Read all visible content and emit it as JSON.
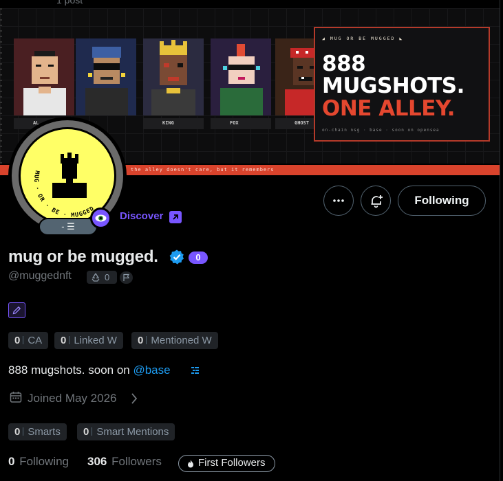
{
  "topbar": {
    "post_count_label": "1 post"
  },
  "banner": {
    "strip_text": "the alley doesn't care, but it remembers",
    "mug_labels": [
      "AL",
      "KING",
      "FOX",
      "GHOST"
    ],
    "promo": {
      "kicker": "◢ MUG OR BE MUGGED ◣",
      "line1": "888",
      "line2": "MUGSHOTS.",
      "line3": "ONE ALLEY.",
      "footer": "on-chain nsg · base · soon on opensea"
    },
    "colors": {
      "accent_red": "#d9432c",
      "promo_red": "#e4472f"
    }
  },
  "avatar": {
    "ring_text": "MUG · OR · BE · MUGGED",
    "pill_label": "- ☰"
  },
  "actions": {
    "more_icon": "more-icon",
    "notify_icon": "bell-plus-icon",
    "following_label": "Following"
  },
  "discover": {
    "label": "Discover"
  },
  "profile": {
    "name": "mug or be mugged.",
    "name_count": "0",
    "handle": "@muggednft",
    "recycle_count": "0",
    "stats": [
      {
        "value": "0",
        "label": "CA"
      },
      {
        "value": "0",
        "label": "Linked W"
      },
      {
        "value": "0",
        "label": "Mentioned W"
      }
    ],
    "bio_text": "888 mugshots. soon on ",
    "bio_link": "@base",
    "joined": "Joined May 2026",
    "smart_stats": [
      {
        "value": "0",
        "label": "Smarts"
      },
      {
        "value": "0",
        "label": "Smart Mentions"
      }
    ],
    "following_count": "0",
    "following_label": "Following",
    "followers_count": "306",
    "followers_label": "Followers",
    "first_followers_label": "First Followers"
  },
  "colors": {
    "purple": "#7856ff",
    "link_blue": "#1d9bf0",
    "muted": "#71767b",
    "pill_bg": "#202327"
  }
}
